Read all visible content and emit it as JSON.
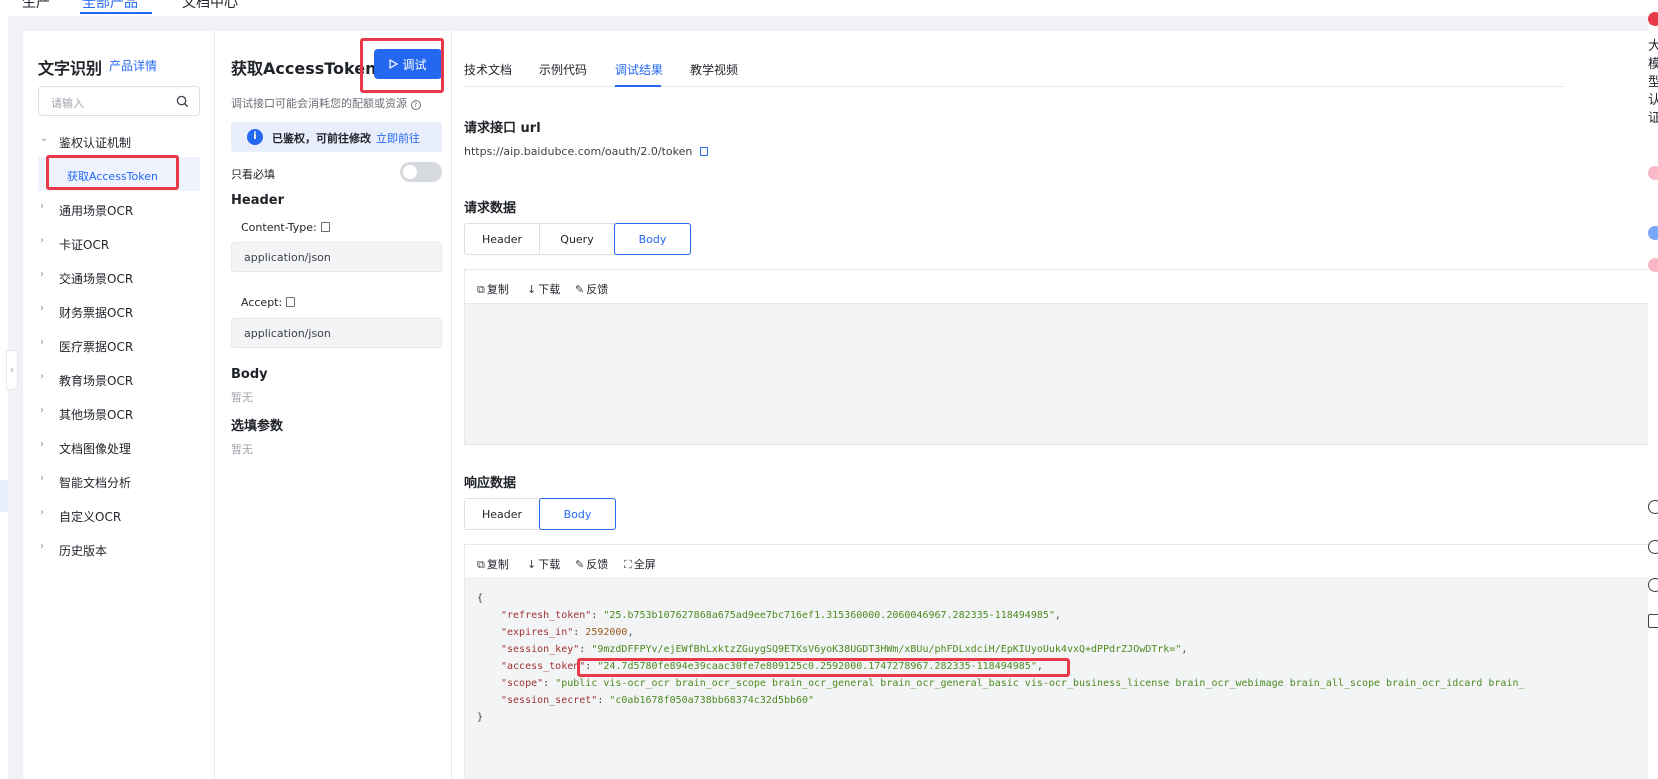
{
  "topnav": {
    "tab1": "生产",
    "tab2": "全部产品",
    "tab3": "文档中心"
  },
  "sidebar": {
    "title": "文字识别",
    "detail_link": "产品详情",
    "search_placeholder": "请输入",
    "items": [
      {
        "label": "鉴权认证机制",
        "expanded": true
      },
      {
        "label": "通用场景OCR"
      },
      {
        "label": "卡证OCR"
      },
      {
        "label": "交通场景OCR"
      },
      {
        "label": "财务票据OCR"
      },
      {
        "label": "医疗票据OCR"
      },
      {
        "label": "教育场景OCR"
      },
      {
        "label": "其他场景OCR"
      },
      {
        "label": "文档图像处理"
      },
      {
        "label": "智能文档分析"
      },
      {
        "label": "自定义OCR"
      },
      {
        "label": "历史版本"
      }
    ],
    "selected_sub": "获取AccessToken"
  },
  "middle": {
    "title": "获取AccessToken",
    "debug_button": "调试",
    "warning": "调试接口可能会消耗您的配额或资源",
    "info_text": "已鉴权，可前往修改",
    "info_link": "立即前往",
    "required_only": "只看必填",
    "header_title": "Header",
    "content_type_label": "Content-Type:",
    "content_type_value": "application/json",
    "accept_label": "Accept:",
    "accept_value": "application/json",
    "body_title": "Body",
    "body_empty": "暂无",
    "optional_title": "选填参数",
    "optional_empty": "暂无"
  },
  "right": {
    "tabs": [
      "技术文档",
      "示例代码",
      "调试结果",
      "教学视频"
    ],
    "active_tab": "调试结果",
    "url_title": "请求接口 url",
    "url": "https://aip.baidubce.com/oauth/2.0/token",
    "request_title": "请求数据",
    "request_segments": [
      "Header",
      "Query",
      "Body"
    ],
    "request_active": "Body",
    "tool_copy": "复制",
    "tool_download": "下载",
    "tool_feedback": "反馈",
    "tool_fullscreen": "全屏",
    "response_title": "响应数据",
    "response_segments": [
      "Header",
      "Body"
    ],
    "response_active": "Body",
    "json_open": "{",
    "json_close": "}",
    "response": [
      {
        "key": "\"refresh_token\"",
        "value": "\"25.b753b107627868a675ad9ee7bc716ef1.315360000.2060046967.282335-118494985\"",
        "type": "string"
      },
      {
        "key": "\"expires_in\"",
        "value": "2592000",
        "type": "number"
      },
      {
        "key": "\"session_key\"",
        "value": "\"9mzdDFFPYv/ejEWfBhLxktzZGuygSQ9ETXsV6yoK38UGDT3HWm/xBUu/phFDLxdciH/EpKIUyoUuk4vxQ+dPPdrZJOwDTrk=\"",
        "type": "string"
      },
      {
        "key": "\"access_token\"",
        "value": "\"24.7d5780fe894e39caac30fe7e809125c0.2592000.1747278967.282335-118494985\"",
        "type": "string"
      },
      {
        "key": "\"scope\"",
        "value": "\"public vis-ocr_ocr brain_ocr_scope brain_ocr_general brain_ocr_general_basic vis-ocr_business_license brain_ocr_webimage brain_all_scope brain_ocr_idcard brain_",
        "type": "string"
      },
      {
        "key": "\"session_secret\"",
        "value": "\"c0ab1678f050a738bb68374c32d5bb60\"",
        "type": "string"
      }
    ]
  },
  "float_bar": {
    "chars": "大模型认证"
  },
  "colors": {
    "accent": "#2468f2",
    "highlight": "#e8394a",
    "json_key": "#a03333",
    "json_string": "#4d8a1f"
  }
}
